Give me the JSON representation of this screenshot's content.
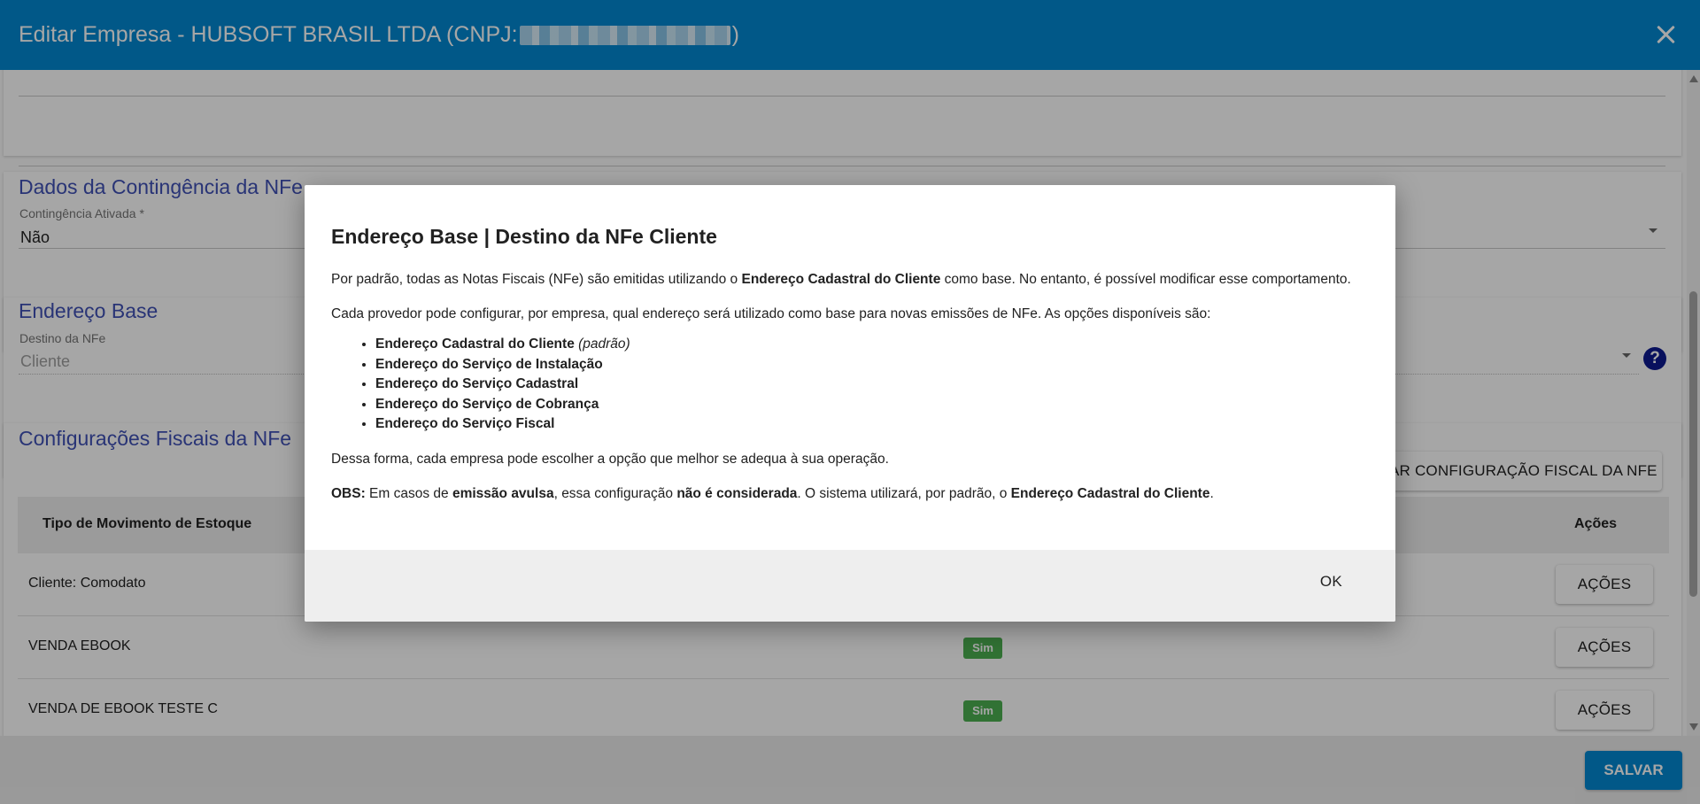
{
  "header": {
    "title_prefix": "Editar Empresa - HUBSOFT BRASIL LTDA (CNPJ: ",
    "title_suffix": ")"
  },
  "sections": {
    "contingencia": {
      "title": "Dados da Contingência da NFe",
      "label": "Contingência Ativada",
      "required_mark": "*",
      "value": "Não"
    },
    "endereco": {
      "title": "Endereço Base",
      "label": "Destino da NFe",
      "value": "Cliente",
      "help": "?"
    },
    "fiscal": {
      "title": "Configurações Fiscais da NFe",
      "add_button": "AR CONFIGURAÇÃO FISCAL DA NFE",
      "columns": {
        "tipo": "Tipo de Movimento de Estoque",
        "acoes": "Ações"
      },
      "rows": [
        {
          "tipo": "Cliente: Comodato",
          "ativo": "",
          "acoes": "AÇÕES"
        },
        {
          "tipo": "VENDA EBOOK",
          "ativo": "Sim",
          "acoes": "AÇÕES"
        },
        {
          "tipo": "VENDA DE EBOOK TESTE C",
          "ativo": "Sim",
          "acoes": "AÇÕES"
        }
      ]
    }
  },
  "footer": {
    "save": "SALVAR"
  },
  "modal": {
    "title": "Endereço Base | Destino da NFe Cliente",
    "p1_a": "Por padrão, todas as Notas Fiscais (NFe) são emitidas utilizando o ",
    "p1_b": "Endereço Cadastral do Cliente",
    "p1_c": " como base. No entanto, é possível modificar esse comportamento.",
    "p2": "Cada provedor pode configurar, por empresa, qual endereço será utilizado como base para novas emissões de NFe. As opções disponíveis são:",
    "options": [
      {
        "label": "Endereço Cadastral do Cliente",
        "note": "(padrão)"
      },
      {
        "label": "Endereço do Serviço de Instalação",
        "note": ""
      },
      {
        "label": "Endereço do Serviço Cadastral",
        "note": ""
      },
      {
        "label": "Endereço do Serviço de Cobrança",
        "note": ""
      },
      {
        "label": "Endereço do Serviço Fiscal",
        "note": ""
      }
    ],
    "p3": "Dessa forma, cada empresa pode escolher a opção que melhor se adequa à sua operação.",
    "obs_label": "OBS:",
    "obs_a": " Em casos de ",
    "obs_b": "emissão avulsa",
    "obs_c": ", essa configuração ",
    "obs_d": "não é considerada",
    "obs_e": ". O sistema utilizará, por padrão, o ",
    "obs_f": "Endereço Cadastral do Cliente",
    "obs_g": ".",
    "ok": "OK"
  }
}
